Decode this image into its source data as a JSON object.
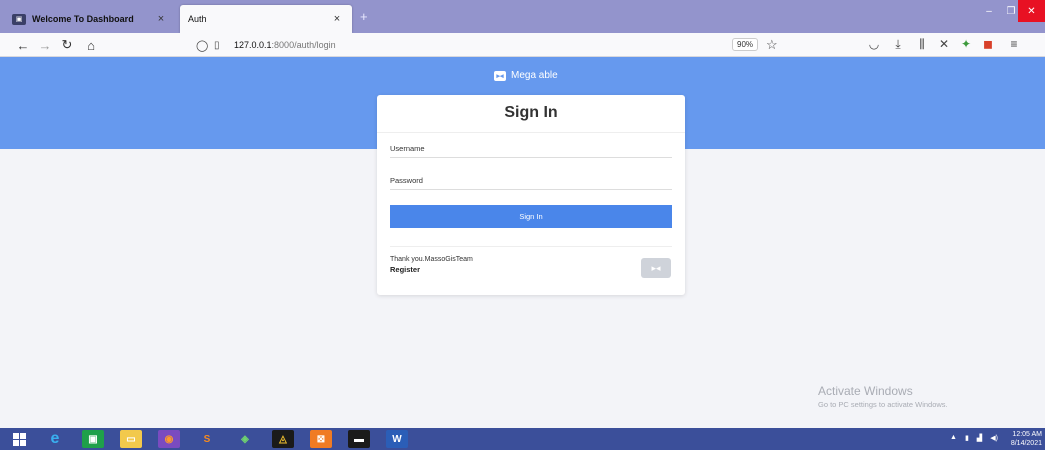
{
  "browser": {
    "tabs": [
      {
        "title": "Welcome To Dashboard",
        "active": false
      },
      {
        "title": "Auth",
        "active": true
      }
    ],
    "url_host": "127.0.0.1",
    "url_path": ":8000/auth/login",
    "zoom": "90%"
  },
  "brand": {
    "name": "Mega able"
  },
  "login": {
    "title": "Sign In",
    "username_placeholder": "Username",
    "password_placeholder": "Password",
    "signin_label": "Sign In",
    "thanks_text": "Thank you.MassoGisTeam",
    "register_label": "Register"
  },
  "watermark": {
    "line1": "Activate Windows",
    "line2": "Go to PC settings to activate Windows."
  },
  "taskbar": {
    "time": "12:05 AM",
    "date": "8/14/2021"
  },
  "colors": {
    "hero": "#6699ee",
    "button": "#4a86ea",
    "tabstrip": "#9394cc",
    "taskbar": "#3b4f9a"
  }
}
